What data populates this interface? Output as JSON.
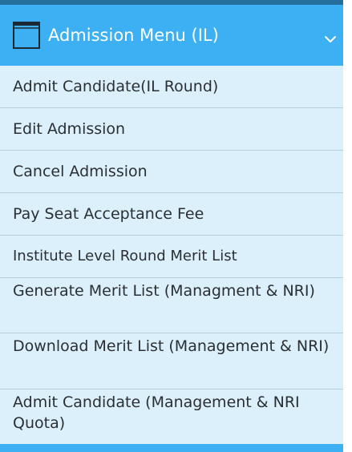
{
  "menu": {
    "header": {
      "title": "Admission Menu (IL)",
      "icon": "window-icon",
      "toggle_icon": "chevron-down-icon"
    },
    "items": [
      {
        "label": "Admit Candidate(IL Round)"
      },
      {
        "label": "Edit Admission"
      },
      {
        "label": "Cancel Admission"
      },
      {
        "label": "Pay Seat Acceptance Fee"
      },
      {
        "label": "Institute Level Round Merit List"
      },
      {
        "label": "Generate Merit List (Managment & NRI)"
      },
      {
        "label": "Download Merit List (Management & NRI)"
      },
      {
        "label": "Admit Candidate (Management & NRI Quota)"
      }
    ]
  },
  "colors": {
    "header_background": "#3cb0f2",
    "top_strip": "#256f9e",
    "item_background": "#dcf0fc",
    "item_divider": "#b8cfe0",
    "item_text": "#2b2f33",
    "header_text": "#ffffff"
  }
}
